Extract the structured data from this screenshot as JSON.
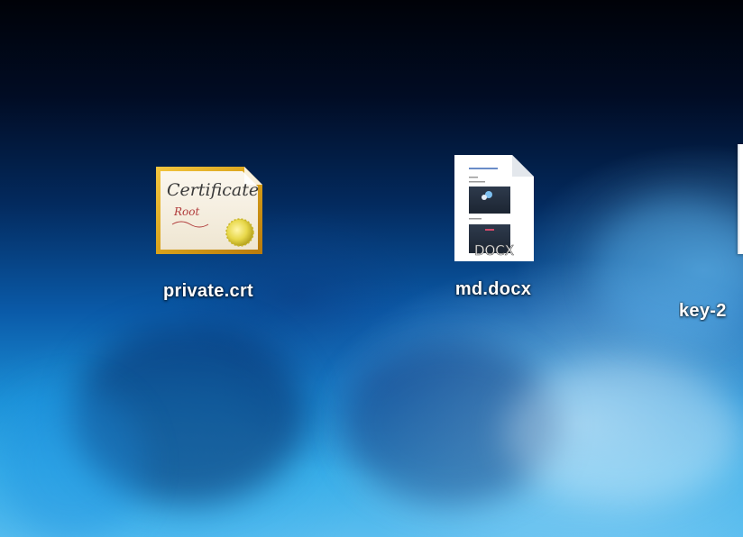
{
  "desktop": {
    "icons": [
      {
        "name": "private.crt",
        "icon": "certificate-icon",
        "thumbnail_text": [
          "Certificate",
          "Root"
        ]
      },
      {
        "name": "md.docx",
        "icon": "docx-document-icon",
        "badge": "DOCX"
      },
      {
        "name": "key-2",
        "icon": "file-icon"
      }
    ]
  },
  "colors": {
    "background_top": "#000208",
    "background_bottom": "#59bdef",
    "certificate_border": "#d9a21b",
    "certificate_seal": "#e8d84a",
    "label_text": "#ffffff"
  }
}
